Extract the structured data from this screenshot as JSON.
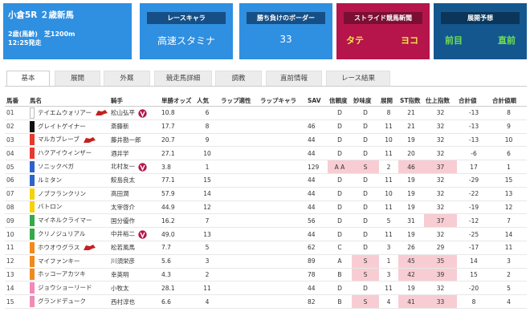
{
  "race": {
    "title": "小倉5R ２歳新馬",
    "cond": "2歳(馬齢)　芝1200m",
    "time": "12:25発走"
  },
  "cards": [
    {
      "header": "レースキャラ",
      "value": "高速スタミナ"
    },
    {
      "header": "勝ち負けのボーダー",
      "value": "33"
    },
    {
      "header": "ストライド競馬新聞",
      "left": "タテ",
      "right": "ヨコ"
    },
    {
      "header": "展開予想",
      "left": "前目",
      "right": "直前"
    }
  ],
  "tabs": [
    "基本",
    "展開",
    "外厩",
    "競走馬詳細",
    "調教",
    "直前情報",
    "レース結果"
  ],
  "columns": [
    "馬番",
    "馬名",
    "騎手",
    "単勝オッズ",
    "人気",
    "ラップ適性",
    "ラップキャラ",
    "SAV",
    "信頼度",
    "妙味度",
    "展開",
    "ST指数",
    "仕上指数",
    "合計値",
    "合計値順"
  ],
  "colors": {
    "accent": "#2f8fe0",
    "shinbun": "#b5154b",
    "tenkai": "#14578f",
    "highlight": "#f7cdd3"
  },
  "rows": [
    {
      "no": "01",
      "name": "テイエムウォリアー",
      "color": "#ffffff",
      "jockey": "松山弘平",
      "odds": "10.8",
      "pop": "6",
      "sav": "",
      "shin": "D",
      "myo": "D",
      "ten": "8",
      "st": "21",
      "shiage": "32",
      "gokei": "-13",
      "jun": "8",
      "fav": true,
      "v": true,
      "hl": []
    },
    {
      "no": "02",
      "name": "グレイトゲイナー",
      "color": "#111111",
      "jockey": "斎藤新",
      "odds": "17.7",
      "pop": "8",
      "sav": "46",
      "shin": "D",
      "myo": "D",
      "ten": "11",
      "st": "21",
      "shiage": "32",
      "gokei": "-13",
      "jun": "9",
      "fav": false,
      "v": false,
      "hl": []
    },
    {
      "no": "03",
      "name": "マルカブレーブ",
      "color": "#e63a2d",
      "jockey": "藤井勘一郎",
      "odds": "20.7",
      "pop": "9",
      "sav": "44",
      "shin": "D",
      "myo": "D",
      "ten": "10",
      "st": "19",
      "shiage": "32",
      "gokei": "-13",
      "jun": "10",
      "fav": true,
      "v": false,
      "hl": []
    },
    {
      "no": "04",
      "name": "ハクアイウィンザー",
      "color": "#e63a2d",
      "jockey": "酒井学",
      "odds": "27.1",
      "pop": "10",
      "sav": "44",
      "shin": "D",
      "myo": "D",
      "ten": "11",
      "st": "20",
      "shiage": "32",
      "gokei": "-6",
      "jun": "6",
      "fav": false,
      "v": false,
      "hl": []
    },
    {
      "no": "05",
      "name": "ソニックベガ",
      "color": "#2c64c8",
      "jockey": "北村友一",
      "odds": "3.8",
      "pop": "1",
      "sav": "129",
      "shin": "A A",
      "myo": "S",
      "ten": "2",
      "st": "46",
      "shiage": "37",
      "gokei": "17",
      "jun": "1",
      "fav": false,
      "v": true,
      "hl": [
        "shin",
        "myo",
        "st",
        "shiage"
      ]
    },
    {
      "no": "06",
      "name": "ルミタン",
      "color": "#2c64c8",
      "jockey": "鮫島良太",
      "odds": "77.1",
      "pop": "15",
      "sav": "44",
      "shin": "D",
      "myo": "D",
      "ten": "11",
      "st": "19",
      "shiage": "32",
      "gokei": "-29",
      "jun": "15",
      "fav": false,
      "v": false,
      "hl": []
    },
    {
      "no": "07",
      "name": "ノブフランクリン",
      "color": "#f5d20a",
      "jockey": "高田潤",
      "odds": "57.9",
      "pop": "14",
      "sav": "44",
      "shin": "D",
      "myo": "D",
      "ten": "10",
      "st": "19",
      "shiage": "32",
      "gokei": "-22",
      "jun": "13",
      "fav": false,
      "v": false,
      "hl": []
    },
    {
      "no": "08",
      "name": "バトロン",
      "color": "#f5d20a",
      "jockey": "太宰啓介",
      "odds": "44.9",
      "pop": "12",
      "sav": "44",
      "shin": "D",
      "myo": "D",
      "ten": "11",
      "st": "19",
      "shiage": "32",
      "gokei": "-19",
      "jun": "12",
      "fav": false,
      "v": false,
      "hl": []
    },
    {
      "no": "09",
      "name": "マイネルクライマー",
      "color": "#35a84a",
      "jockey": "国分優作",
      "odds": "16.2",
      "pop": "7",
      "sav": "56",
      "shin": "D",
      "myo": "D",
      "ten": "5",
      "st": "31",
      "shiage": "37",
      "gokei": "-12",
      "jun": "7",
      "fav": false,
      "v": false,
      "hl": [
        "shiage"
      ]
    },
    {
      "no": "10",
      "name": "クリノジュリアル",
      "color": "#35a84a",
      "jockey": "中井裕二",
      "odds": "49.0",
      "pop": "13",
      "sav": "44",
      "shin": "D",
      "myo": "D",
      "ten": "11",
      "st": "19",
      "shiage": "32",
      "gokei": "-25",
      "jun": "14",
      "fav": false,
      "v": true,
      "hl": []
    },
    {
      "no": "11",
      "name": "ホウオウグラス",
      "color": "#f08a1c",
      "jockey": "松若風馬",
      "odds": "7.7",
      "pop": "5",
      "sav": "62",
      "shin": "C",
      "myo": "D",
      "ten": "3",
      "st": "26",
      "shiage": "29",
      "gokei": "-17",
      "jun": "11",
      "fav": true,
      "v": false,
      "hl": []
    },
    {
      "no": "12",
      "name": "マイファンキー",
      "color": "#f08a1c",
      "jockey": "川須栄彦",
      "odds": "5.6",
      "pop": "3",
      "sav": "89",
      "shin": "A",
      "myo": "S",
      "ten": "1",
      "st": "45",
      "shiage": "35",
      "gokei": "14",
      "jun": "3",
      "fav": false,
      "v": false,
      "hl": [
        "myo",
        "st",
        "shiage"
      ]
    },
    {
      "no": "13",
      "name": "ホッコーアカツキ",
      "color": "#f08a1c",
      "jockey": "幸英明",
      "odds": "4.3",
      "pop": "2",
      "sav": "78",
      "shin": "B",
      "myo": "S",
      "ten": "3",
      "st": "42",
      "shiage": "39",
      "gokei": "15",
      "jun": "2",
      "fav": false,
      "v": false,
      "hl": [
        "myo",
        "st",
        "shiage"
      ]
    },
    {
      "no": "14",
      "name": "ジョウショーリード",
      "color": "#f28ab8",
      "jockey": "小牧太",
      "odds": "28.1",
      "pop": "11",
      "sav": "44",
      "shin": "D",
      "myo": "D",
      "ten": "11",
      "st": "19",
      "shiage": "32",
      "gokei": "-20",
      "jun": "5",
      "fav": false,
      "v": false,
      "hl": []
    },
    {
      "no": "15",
      "name": "グランドデューク",
      "color": "#f28ab8",
      "jockey": "西村淳也",
      "odds": "6.6",
      "pop": "4",
      "sav": "82",
      "shin": "B",
      "myo": "S",
      "ten": "4",
      "st": "41",
      "shiage": "33",
      "gokei": "8",
      "jun": "4",
      "fav": false,
      "v": false,
      "hl": [
        "myo",
        "st",
        "shiage"
      ]
    }
  ]
}
